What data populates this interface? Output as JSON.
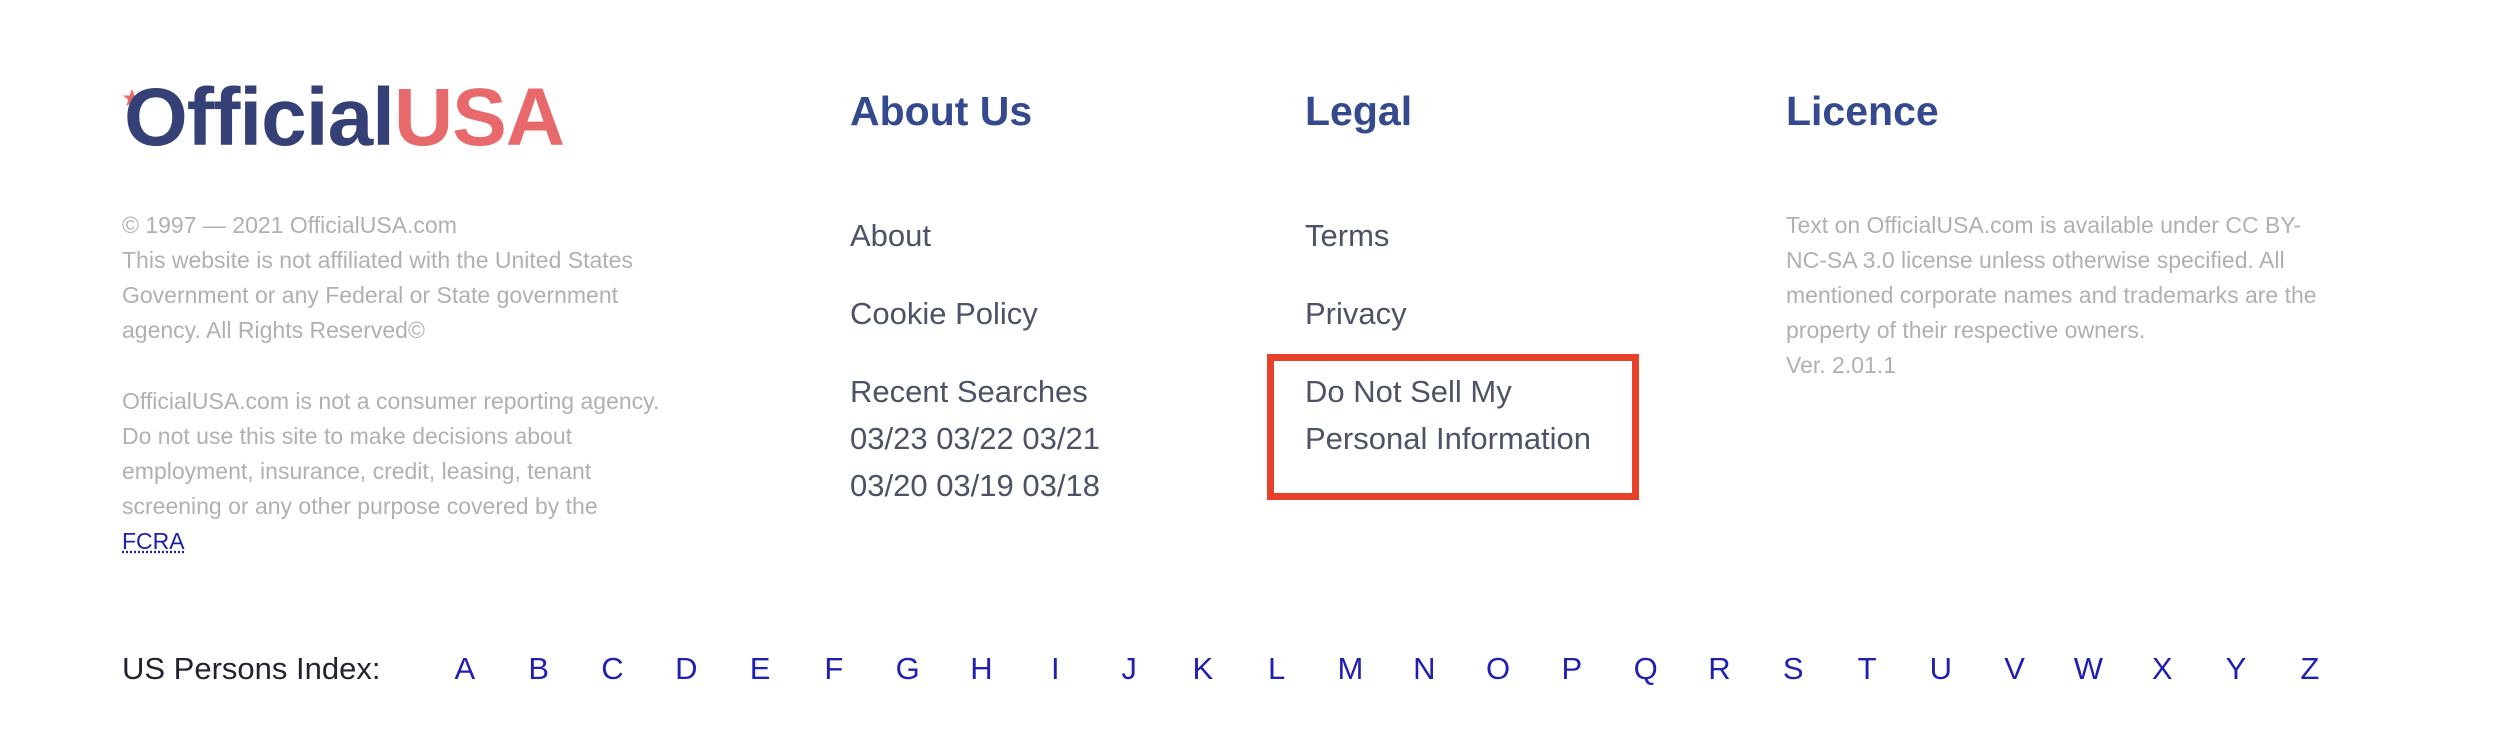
{
  "brand": {
    "logo_left": "Official",
    "logo_right": "USA",
    "copyright": "© 1997 — 2021 OfficialUSA.com",
    "affiliation": "This website is not affiliated with the United States Government or any Federal or State government agency. All Rights Reserved©",
    "disclaimer_prefix": "OfficialUSA.com is not a consumer reporting agency. Do not use this site to make decisions about employment, insurance, credit, leasing, tenant screening or any other purpose covered by the",
    "fcra_link": "FCRA"
  },
  "about": {
    "heading": "About Us",
    "about_link": "About",
    "cookie_link": "Cookie Policy",
    "recent_label": "Recent Searches",
    "recent_row1": "03/23 03/22 03/21",
    "recent_row2": "03/20 03/19 03/18"
  },
  "legal": {
    "heading": "Legal",
    "terms_link": "Terms",
    "privacy_link": "Privacy",
    "dnsmpi_line1": "Do Not Sell My",
    "dnsmpi_line2": "Personal Information"
  },
  "licence": {
    "heading": "Licence",
    "text": "Text on OfficialUSA.com is available under CC BY-NC-SA 3.0 license unless otherwise specified. All mentioned corporate names and trademarks are the property of their respective owners.",
    "version": "Ver. 2.01.1"
  },
  "index": {
    "label": "US Persons Index:",
    "letters": [
      "A",
      "B",
      "C",
      "D",
      "E",
      "F",
      "G",
      "H",
      "I",
      "J",
      "K",
      "L",
      "M",
      "N",
      "O",
      "P",
      "Q",
      "R",
      "S",
      "T",
      "U",
      "V",
      "W",
      "X",
      "Y",
      "Z"
    ]
  },
  "colors": {
    "brand_navy": "#354076",
    "brand_red": "#e8696b",
    "heading": "#354a8e",
    "link_blue": "#1f1fb0",
    "highlight": "#e8412a"
  },
  "icons": {
    "logo_star": "star-icon"
  }
}
